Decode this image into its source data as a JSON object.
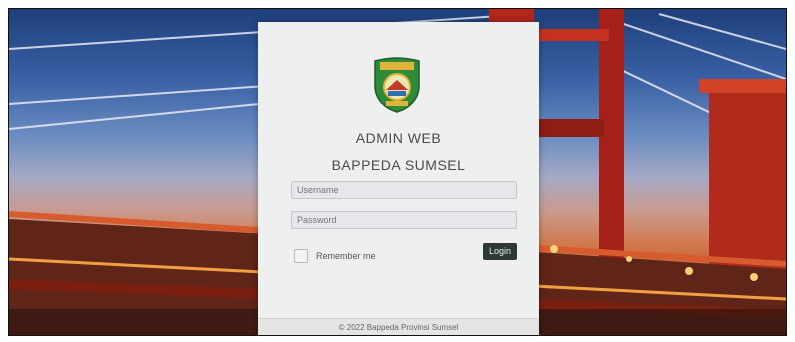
{
  "login": {
    "title_line1": "ADMIN WEB",
    "title_line2": "BAPPEDA SUMSEL",
    "username_placeholder": "Username",
    "password_placeholder": "Password",
    "remember_label": "Remember me",
    "login_label": "Login",
    "footer": "© 2022 Bappeda Provinsi Sumsel"
  },
  "colors": {
    "panel_bg": "#eef0f0",
    "login_button": "#2f3a34",
    "logo_green": "#2e8b3a",
    "logo_gold": "#e0b43a"
  },
  "icons": {
    "logo": "provincial-emblem-shield"
  }
}
